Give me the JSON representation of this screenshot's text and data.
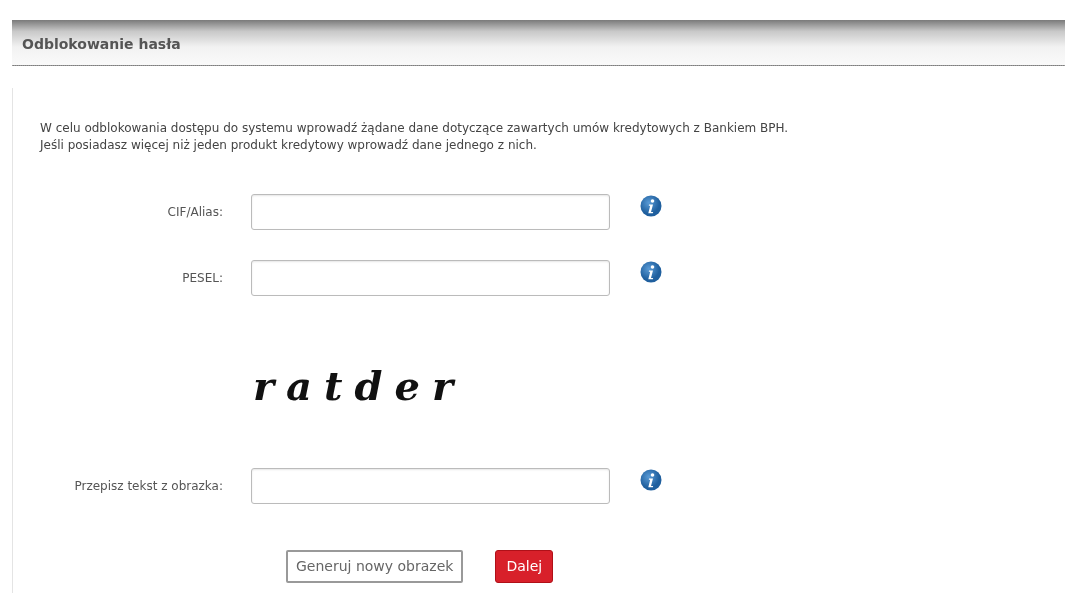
{
  "panel": {
    "title": "Odblokowanie hasła"
  },
  "intro": [
    "W celu odblokowania dostępu do systemu wprowadź żądane dane dotyczące zawartych umów kredytowych z Bankiem BPH.",
    "Jeśli posiadasz więcej niż jeden produkt kredytowy wprowadź dane jednego z nich."
  ],
  "fields": [
    {
      "label": "CIF/Alias:"
    },
    {
      "label": "PESEL:"
    }
  ],
  "captcha": {
    "text": "ratder"
  },
  "captcha_field": {
    "label": "Przepisz tekst z obrazka:"
  },
  "buttons": [
    {
      "label": "Generuj nowy obrazek",
      "kind": "secondary"
    },
    {
      "label": "Dalej",
      "kind": "primary"
    }
  ]
}
